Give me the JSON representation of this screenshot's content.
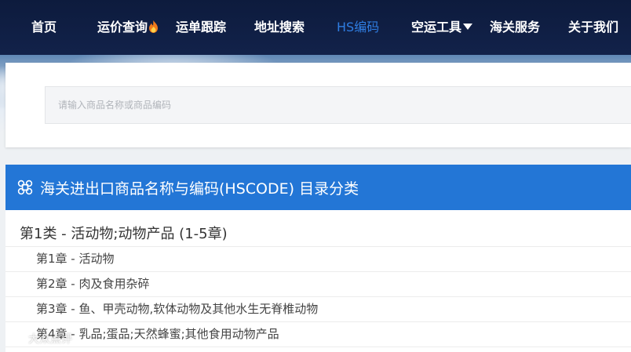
{
  "nav": {
    "items": [
      {
        "label": "首页"
      },
      {
        "label": "运价查询"
      },
      {
        "label": "运单跟踪"
      },
      {
        "label": "地址搜索"
      },
      {
        "label": "HS编码"
      },
      {
        "label": "空运工具"
      },
      {
        "label": "海关服务"
      },
      {
        "label": "关于我们"
      }
    ],
    "active_color": "#2f7de1",
    "bg_color": "#0d1b3d"
  },
  "search": {
    "placeholder": "请输入商品名称或商品编码",
    "value": ""
  },
  "catalog": {
    "title": "海关进出口商品名称与编码(HSCODE) 目录分类",
    "header_color": "#2376d6",
    "icon": "command-icon",
    "classes": [
      {
        "label": "第1类 - 活动物;动物产品 (1-5章)",
        "chapters": [
          {
            "label": "第1章 - 活动物"
          },
          {
            "label": "第2章 - 肉及食用杂碎"
          },
          {
            "label": "第3章 - 鱼、甲壳动物,软体动物及其他水生无脊椎动物"
          },
          {
            "label": "第4章 - 乳品;蛋品;天然蜂蜜;其他食用动物产品"
          }
        ]
      }
    ]
  },
  "watermark": {
    "logo": "watermark-logo-icon",
    "text": "大众点评"
  }
}
